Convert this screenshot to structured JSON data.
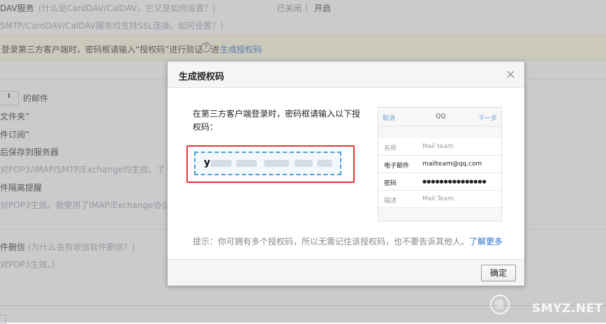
{
  "background": {
    "dav_title": "DAV服务",
    "dav_help": "(什么是CardDAV/CalDAV，它又是如何设置？)",
    "dav_status_off": "已关闭",
    "dav_sep": "|",
    "dav_status_on": "开启",
    "ssl_text": "SMTP/CardDAV/CalDAV服务均支持SSL连接。如何设置？)",
    "notice_text": "登录第三方客户端时，密码框请输入“授权码”进行验证",
    "notice_help_glyph": "?",
    "notice_link": "生成授权码",
    "select_value": "",
    "select_suffix": "的邮件",
    "line_folder": "文件夹”",
    "line_subscribe": "件订阅”",
    "line_save": "后保存到服务器",
    "line_pop_imap": "对POP3/IMAP/SMTP/Exchange均生效。了",
    "line_remind": "件隔离提醒",
    "line_pop3_only": "对POP3生效。我使用了IMAP/Exchange协议",
    "line_delete": "件删信",
    "line_delete_help": "(为什么会有收信软件删信？)",
    "line_pop3_only2": "对POP3生效。)"
  },
  "modal": {
    "title": "生成授权码",
    "close_glyph": "×",
    "instruction": "在第三方客户端登录时，密码框请输入以下授权码：",
    "code_visible": "y",
    "phone": {
      "nav_left": "取消",
      "nav_title": "QQ",
      "nav_right": "下一步",
      "rows": [
        {
          "label": "名称",
          "value": "Mail team",
          "label_dim": true,
          "value_dim": true
        },
        {
          "label": "电子邮件",
          "value": "mailteam@qq.com",
          "label_dim": false,
          "value_dim": false
        },
        {
          "label": "密码",
          "value": "●●●●●●●●●●●●●●●",
          "label_dim": false,
          "value_dim": false
        },
        {
          "label": "描述",
          "value": "Mail Team",
          "label_dim": true,
          "value_dim": true
        }
      ]
    },
    "tip_text": "提示：你可拥有多个授权码，所以无需记住该授权码，也不要告诉其他人。",
    "tip_link": "了解更多",
    "ok_button": "确定"
  },
  "watermark": {
    "text": "SMYZ.NET",
    "logo_char": "值"
  },
  "colors": {
    "link": "#2a6fc9",
    "notice_bg": "#fffbe4",
    "highlight_border": "#e53333",
    "dashed_border": "#4a9ed8"
  }
}
